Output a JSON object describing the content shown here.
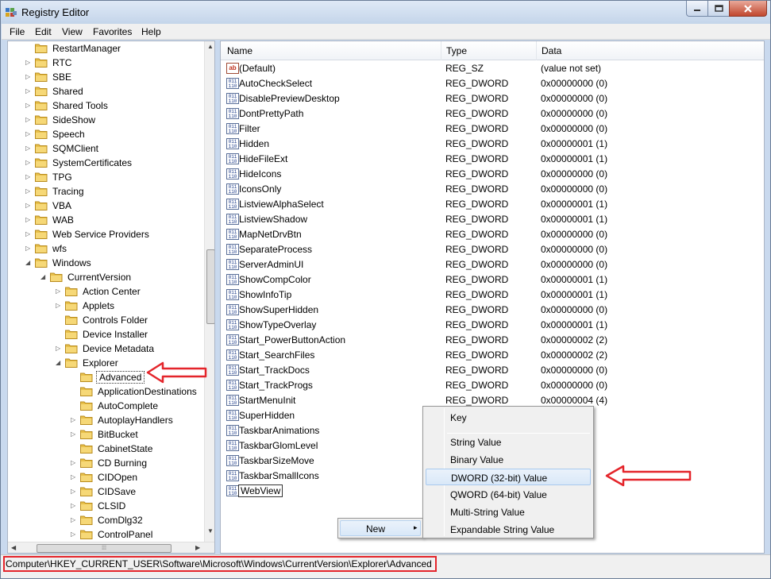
{
  "window": {
    "title": "Registry Editor"
  },
  "menubar": [
    "File",
    "Edit",
    "View",
    "Favorites",
    "Help"
  ],
  "tree": [
    {
      "label": "RestartManager",
      "level": 1,
      "exp": "none"
    },
    {
      "label": "RTC",
      "level": 1,
      "exp": "closed"
    },
    {
      "label": "SBE",
      "level": 1,
      "exp": "closed"
    },
    {
      "label": "Shared",
      "level": 1,
      "exp": "closed"
    },
    {
      "label": "Shared Tools",
      "level": 1,
      "exp": "closed"
    },
    {
      "label": "SideShow",
      "level": 1,
      "exp": "closed"
    },
    {
      "label": "Speech",
      "level": 1,
      "exp": "closed"
    },
    {
      "label": "SQMClient",
      "level": 1,
      "exp": "closed"
    },
    {
      "label": "SystemCertificates",
      "level": 1,
      "exp": "closed"
    },
    {
      "label": "TPG",
      "level": 1,
      "exp": "closed"
    },
    {
      "label": "Tracing",
      "level": 1,
      "exp": "closed"
    },
    {
      "label": "VBA",
      "level": 1,
      "exp": "closed"
    },
    {
      "label": "WAB",
      "level": 1,
      "exp": "closed"
    },
    {
      "label": "Web Service Providers",
      "level": 1,
      "exp": "closed"
    },
    {
      "label": "wfs",
      "level": 1,
      "exp": "closed"
    },
    {
      "label": "Windows",
      "level": 1,
      "exp": "open"
    },
    {
      "label": "CurrentVersion",
      "level": 2,
      "exp": "open"
    },
    {
      "label": "Action Center",
      "level": 3,
      "exp": "closed"
    },
    {
      "label": "Applets",
      "level": 3,
      "exp": "closed"
    },
    {
      "label": "Controls Folder",
      "level": 3,
      "exp": "none"
    },
    {
      "label": "Device Installer",
      "level": 3,
      "exp": "none"
    },
    {
      "label": "Device Metadata",
      "level": 3,
      "exp": "closed"
    },
    {
      "label": "Explorer",
      "level": 3,
      "exp": "open"
    },
    {
      "label": "Advanced",
      "level": 4,
      "exp": "none",
      "selected": true
    },
    {
      "label": "ApplicationDestinations",
      "level": 4,
      "exp": "none"
    },
    {
      "label": "AutoComplete",
      "level": 4,
      "exp": "none"
    },
    {
      "label": "AutoplayHandlers",
      "level": 4,
      "exp": "closed"
    },
    {
      "label": "BitBucket",
      "level": 4,
      "exp": "closed"
    },
    {
      "label": "CabinetState",
      "level": 4,
      "exp": "none"
    },
    {
      "label": "CD Burning",
      "level": 4,
      "exp": "closed"
    },
    {
      "label": "CIDOpen",
      "level": 4,
      "exp": "closed"
    },
    {
      "label": "CIDSave",
      "level": 4,
      "exp": "closed"
    },
    {
      "label": "CLSID",
      "level": 4,
      "exp": "closed"
    },
    {
      "label": "ComDlg32",
      "level": 4,
      "exp": "closed"
    },
    {
      "label": "ControlPanel",
      "level": 4,
      "exp": "closed"
    }
  ],
  "columns": {
    "name": "Name",
    "type": "Type",
    "data": "Data"
  },
  "values": [
    {
      "name": "(Default)",
      "type": "REG_SZ",
      "data": "(value not set)",
      "icon": "string-value-icon"
    },
    {
      "name": "AutoCheckSelect",
      "type": "REG_DWORD",
      "data": "0x00000000 (0)",
      "icon": "dword-value-icon"
    },
    {
      "name": "DisablePreviewDesktop",
      "type": "REG_DWORD",
      "data": "0x00000000 (0)",
      "icon": "dword-value-icon"
    },
    {
      "name": "DontPrettyPath",
      "type": "REG_DWORD",
      "data": "0x00000000 (0)",
      "icon": "dword-value-icon"
    },
    {
      "name": "Filter",
      "type": "REG_DWORD",
      "data": "0x00000000 (0)",
      "icon": "dword-value-icon"
    },
    {
      "name": "Hidden",
      "type": "REG_DWORD",
      "data": "0x00000001 (1)",
      "icon": "dword-value-icon"
    },
    {
      "name": "HideFileExt",
      "type": "REG_DWORD",
      "data": "0x00000001 (1)",
      "icon": "dword-value-icon"
    },
    {
      "name": "HideIcons",
      "type": "REG_DWORD",
      "data": "0x00000000 (0)",
      "icon": "dword-value-icon"
    },
    {
      "name": "IconsOnly",
      "type": "REG_DWORD",
      "data": "0x00000000 (0)",
      "icon": "dword-value-icon"
    },
    {
      "name": "ListviewAlphaSelect",
      "type": "REG_DWORD",
      "data": "0x00000001 (1)",
      "icon": "dword-value-icon"
    },
    {
      "name": "ListviewShadow",
      "type": "REG_DWORD",
      "data": "0x00000001 (1)",
      "icon": "dword-value-icon"
    },
    {
      "name": "MapNetDrvBtn",
      "type": "REG_DWORD",
      "data": "0x00000000 (0)",
      "icon": "dword-value-icon"
    },
    {
      "name": "SeparateProcess",
      "type": "REG_DWORD",
      "data": "0x00000000 (0)",
      "icon": "dword-value-icon"
    },
    {
      "name": "ServerAdminUI",
      "type": "REG_DWORD",
      "data": "0x00000000 (0)",
      "icon": "dword-value-icon"
    },
    {
      "name": "ShowCompColor",
      "type": "REG_DWORD",
      "data": "0x00000001 (1)",
      "icon": "dword-value-icon"
    },
    {
      "name": "ShowInfoTip",
      "type": "REG_DWORD",
      "data": "0x00000001 (1)",
      "icon": "dword-value-icon"
    },
    {
      "name": "ShowSuperHidden",
      "type": "REG_DWORD",
      "data": "0x00000000 (0)",
      "icon": "dword-value-icon"
    },
    {
      "name": "ShowTypeOverlay",
      "type": "REG_DWORD",
      "data": "0x00000001 (1)",
      "icon": "dword-value-icon"
    },
    {
      "name": "Start_PowerButtonAction",
      "type": "REG_DWORD",
      "data": "0x00000002 (2)",
      "icon": "dword-value-icon"
    },
    {
      "name": "Start_SearchFiles",
      "type": "REG_DWORD",
      "data": "0x00000002 (2)",
      "icon": "dword-value-icon"
    },
    {
      "name": "Start_TrackDocs",
      "type": "REG_DWORD",
      "data": "0x00000000 (0)",
      "icon": "dword-value-icon"
    },
    {
      "name": "Start_TrackProgs",
      "type": "REG_DWORD",
      "data": "0x00000000 (0)",
      "icon": "dword-value-icon"
    },
    {
      "name": "StartMenuInit",
      "type": "REG_DWORD",
      "data": "0x00000004 (4)",
      "icon": "dword-value-icon"
    },
    {
      "name": "SuperHidden",
      "type": "",
      "data": "0)",
      "icon": "dword-value-icon"
    },
    {
      "name": "TaskbarAnimations",
      "type": "",
      "data": "1)",
      "icon": "dword-value-icon"
    },
    {
      "name": "TaskbarGlomLevel",
      "type": "",
      "data": "0)",
      "icon": "dword-value-icon"
    },
    {
      "name": "TaskbarSizeMove",
      "type": "",
      "data": "1)",
      "icon": "dword-value-icon"
    },
    {
      "name": "TaskbarSmallIcons",
      "type": "",
      "data": "0)",
      "icon": "dword-value-icon"
    },
    {
      "name": "WebView",
      "type": "",
      "data": "1)",
      "icon": "dword-value-icon",
      "editing": true
    }
  ],
  "context_menu": {
    "new_label": "New",
    "submenu_arrow": "▸"
  },
  "submenu": [
    {
      "label": "Key"
    },
    {
      "label": "String Value"
    },
    {
      "label": "Binary Value"
    },
    {
      "label": "DWORD (32-bit) Value",
      "highlighted": true
    },
    {
      "label": "QWORD (64-bit) Value"
    },
    {
      "label": "Multi-String Value"
    },
    {
      "label": "Expandable String Value"
    }
  ],
  "statusbar": {
    "path": "Computer\\HKEY_CURRENT_USER\\Software\\Microsoft\\Windows\\CurrentVersion\\Explorer\\Advanced"
  },
  "colors": {
    "annotation_red": "#e4252b",
    "folder_yellow": "#e8c04a",
    "window_frame": "#c9d9ee"
  }
}
